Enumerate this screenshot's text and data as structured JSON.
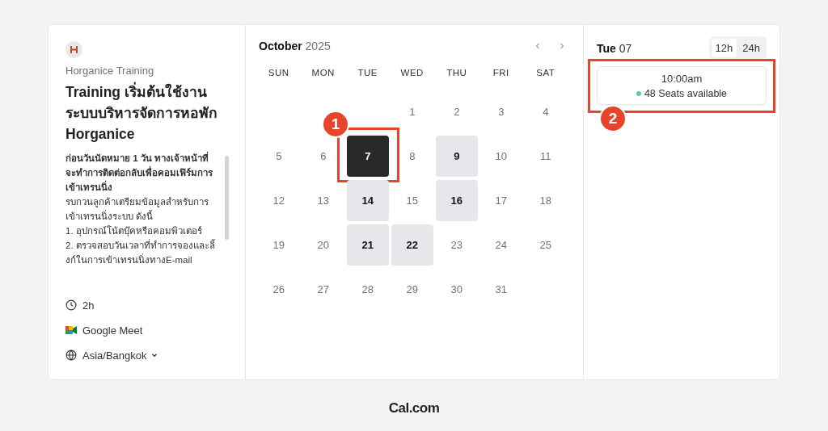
{
  "event": {
    "organizer": "Horganice Training",
    "title": "Training เริ่มต้นใช้งานระบบบริหารจัดการหอพัก Horganice",
    "description": [
      "**ก่อนวันนัดหมาย 1 วัน ทางเจ้าหน้าที่จะทำการติดต่อกลับเพื่อคอมเฟิร์มการเข้าเทรนนิ่ง**",
      "รบกวนลูกค้าเตรียมข้อมูลสำหรับการเข้าเทรนนิ่งระบบ ดังนี้",
      "1. อุปกรณ์โน้ตบุ๊คหรือคอมพิวเตอร์",
      "2. ตรวจสอบวันเวลาที่ทำการจองและลิ้งก์ในการเข้าเทรนนิ่งทางE-mail"
    ],
    "details": [
      {
        "kind": "duration",
        "text": "2h"
      },
      {
        "kind": "meet",
        "text": "Google Meet"
      },
      {
        "kind": "timezone",
        "text": "Asia/Bangkok"
      }
    ]
  },
  "calendar": {
    "month": "October",
    "year": "2025",
    "weekdays": [
      "SUN",
      "MON",
      "TUE",
      "WED",
      "THU",
      "FRI",
      "SAT"
    ],
    "weeks": [
      [
        {
          "day": "1",
          "available": false,
          "selected": false
        },
        {
          "day": "2",
          "available": false,
          "selected": false
        },
        {
          "day": "3",
          "available": false,
          "selected": false
        },
        {
          "day": "4",
          "available": false,
          "selected": false
        }
      ],
      [
        {
          "day": "5",
          "available": false,
          "selected": false
        },
        {
          "day": "6",
          "available": false,
          "selected": false
        },
        {
          "day": "7",
          "available": true,
          "selected": true,
          "callout": "1"
        },
        {
          "day": "8",
          "available": false,
          "selected": false
        },
        {
          "day": "9",
          "available": true,
          "selected": false
        },
        {
          "day": "10",
          "available": false,
          "selected": false
        },
        {
          "day": "11",
          "available": false,
          "selected": false
        }
      ],
      [
        {
          "day": "12",
          "available": false,
          "selected": false
        },
        {
          "day": "13",
          "available": false,
          "selected": false
        },
        {
          "day": "14",
          "available": true,
          "selected": false
        },
        {
          "day": "15",
          "available": false,
          "selected": false
        },
        {
          "day": "16",
          "available": true,
          "selected": false
        },
        {
          "day": "17",
          "available": false,
          "selected": false
        },
        {
          "day": "18",
          "available": false,
          "selected": false
        }
      ],
      [
        {
          "day": "19",
          "available": false,
          "selected": false
        },
        {
          "day": "20",
          "available": false,
          "selected": false
        },
        {
          "day": "21",
          "available": true,
          "selected": false
        },
        {
          "day": "22",
          "available": true,
          "selected": false
        },
        {
          "day": "23",
          "available": false,
          "selected": false
        },
        {
          "day": "24",
          "available": false,
          "selected": false
        },
        {
          "day": "25",
          "available": false,
          "selected": false
        }
      ],
      [
        {
          "day": "26",
          "available": false,
          "selected": false
        },
        {
          "day": "27",
          "available": false,
          "selected": false
        },
        {
          "day": "28",
          "available": false,
          "selected": false
        },
        {
          "day": "29",
          "available": false,
          "selected": false
        },
        {
          "day": "30",
          "available": false,
          "selected": false
        },
        {
          "day": "31",
          "available": false,
          "selected": false
        }
      ]
    ]
  },
  "slots_panel": {
    "weekday": "Tue",
    "date": "07",
    "formats": [
      {
        "label": "12h",
        "selected": true
      },
      {
        "label": "24h",
        "selected": false
      }
    ],
    "slots": [
      {
        "time": "10:00am",
        "seats": "48 Seats available",
        "color": "#5fd08f",
        "callout": "2"
      }
    ]
  },
  "footer": {
    "brand": "Cal.com"
  }
}
